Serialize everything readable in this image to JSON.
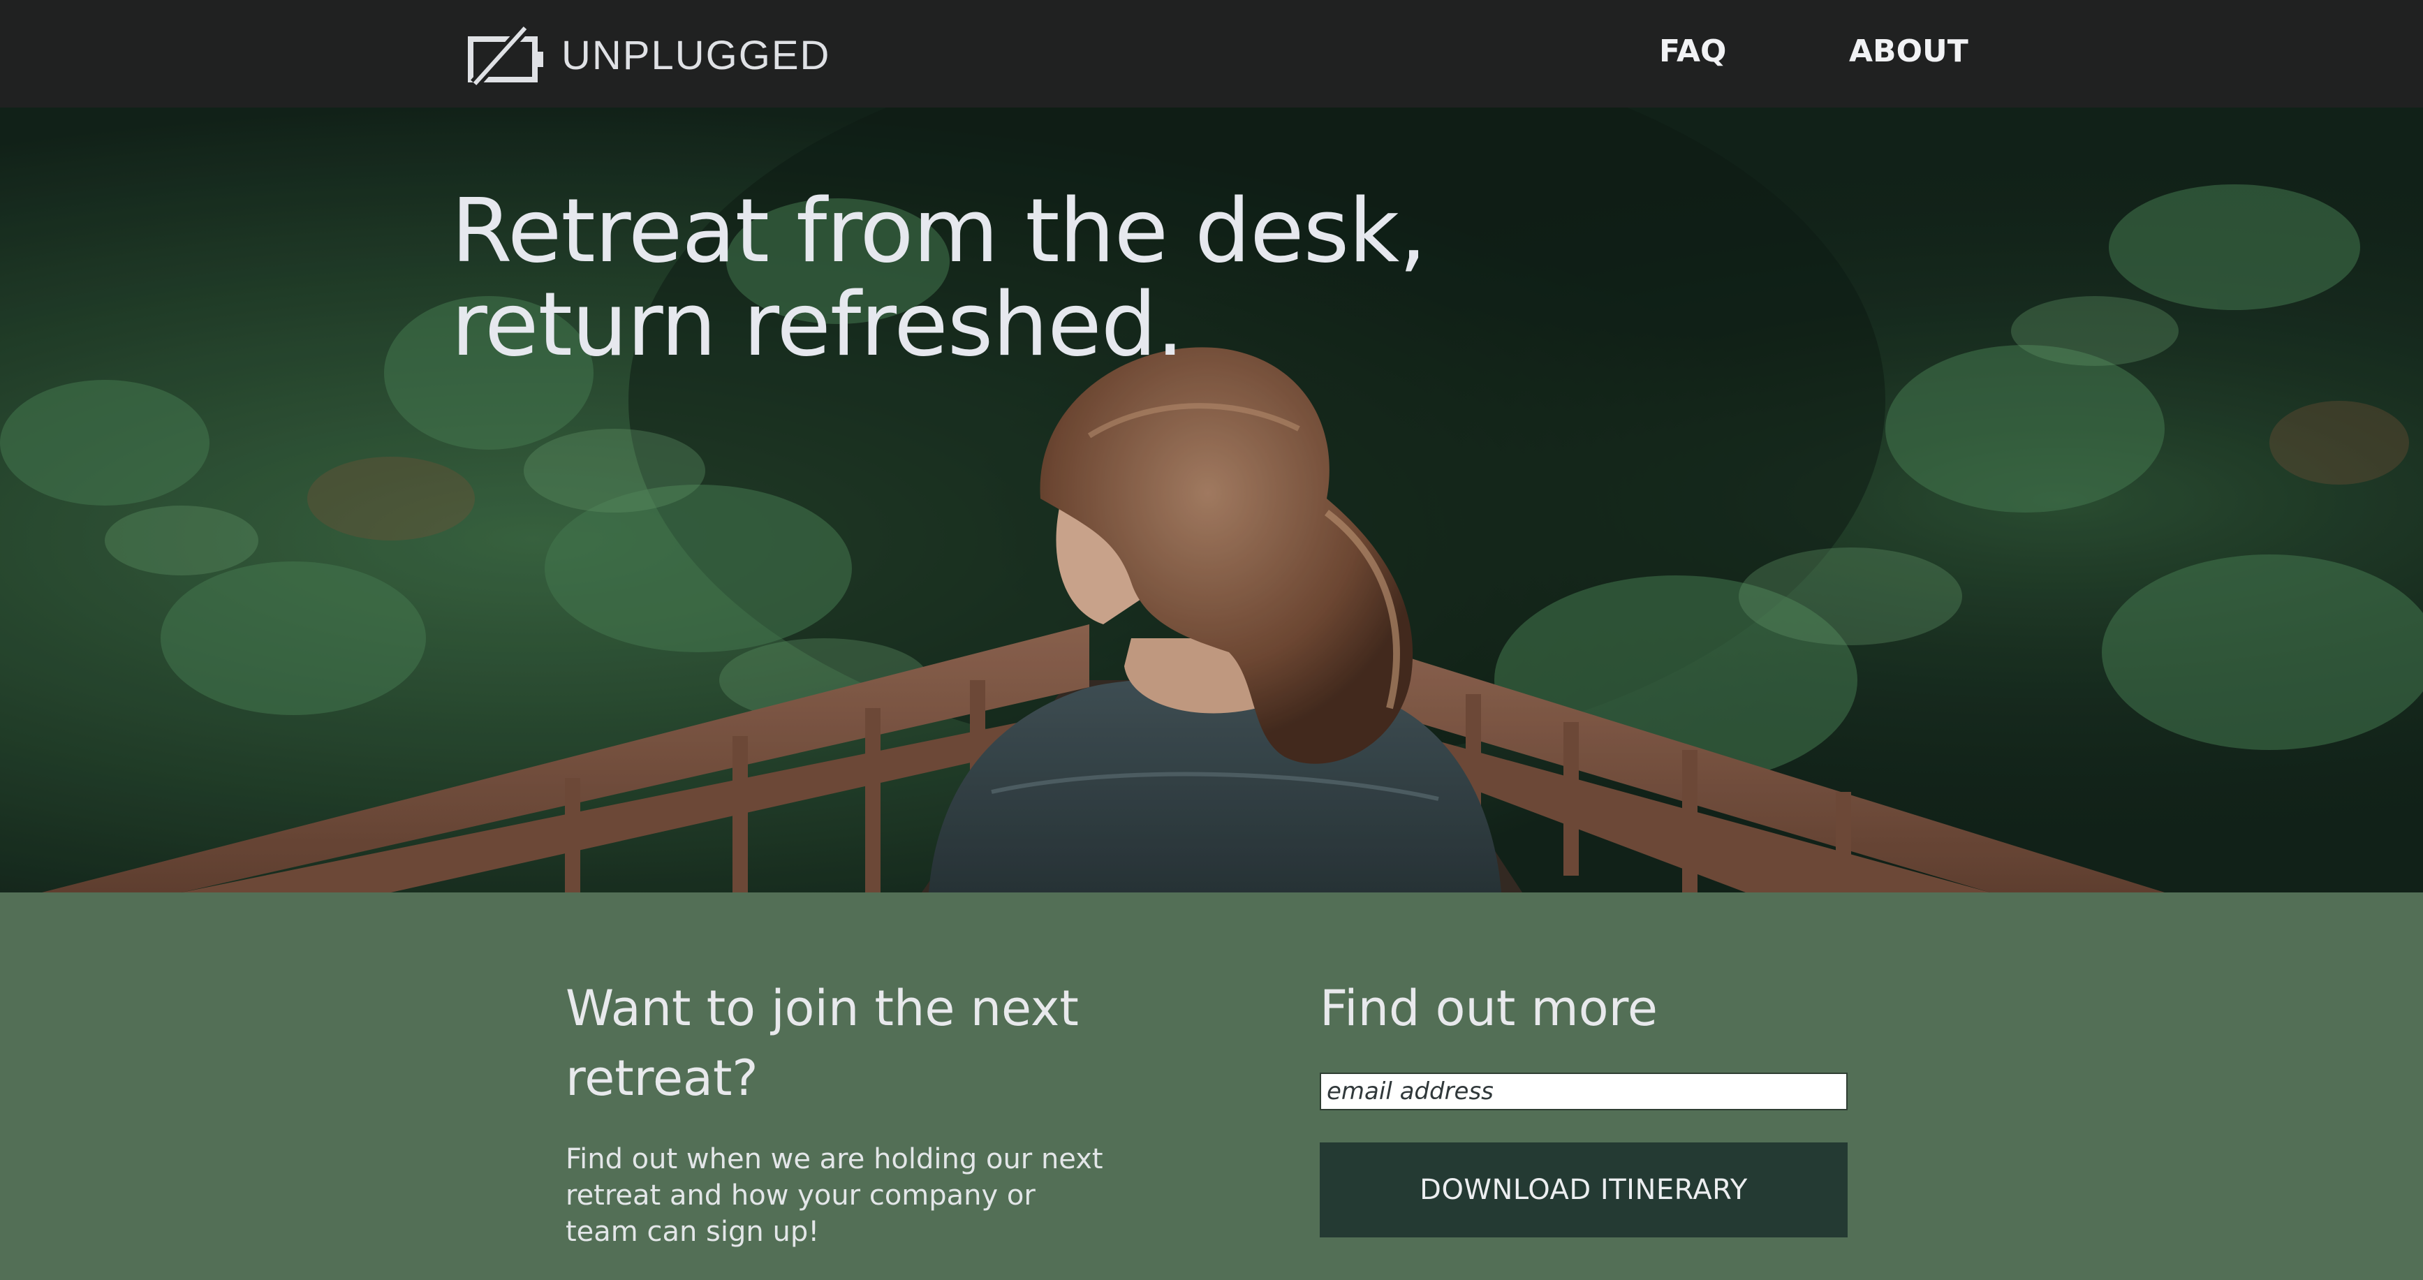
{
  "header": {
    "logo_text": "UNPLUGGED",
    "logo_icon": "unplugged-screen-icon",
    "nav": [
      {
        "label": "FAQ"
      },
      {
        "label": "ABOUT"
      }
    ]
  },
  "hero": {
    "title_line1": "Retreat from the desk,",
    "title_line2": "return refreshed."
  },
  "join": {
    "heading": "Want to join the next retreat?",
    "text": "Find out when we are holding our next retreat and how your company or team can sign up!"
  },
  "signup": {
    "heading": "Find out more",
    "email_placeholder": "email address",
    "button_label": "DOWNLOAD ITINERARY"
  },
  "colors": {
    "header_bg": "#202121",
    "section_bg": "#536f56",
    "button_bg": "#243a33"
  }
}
